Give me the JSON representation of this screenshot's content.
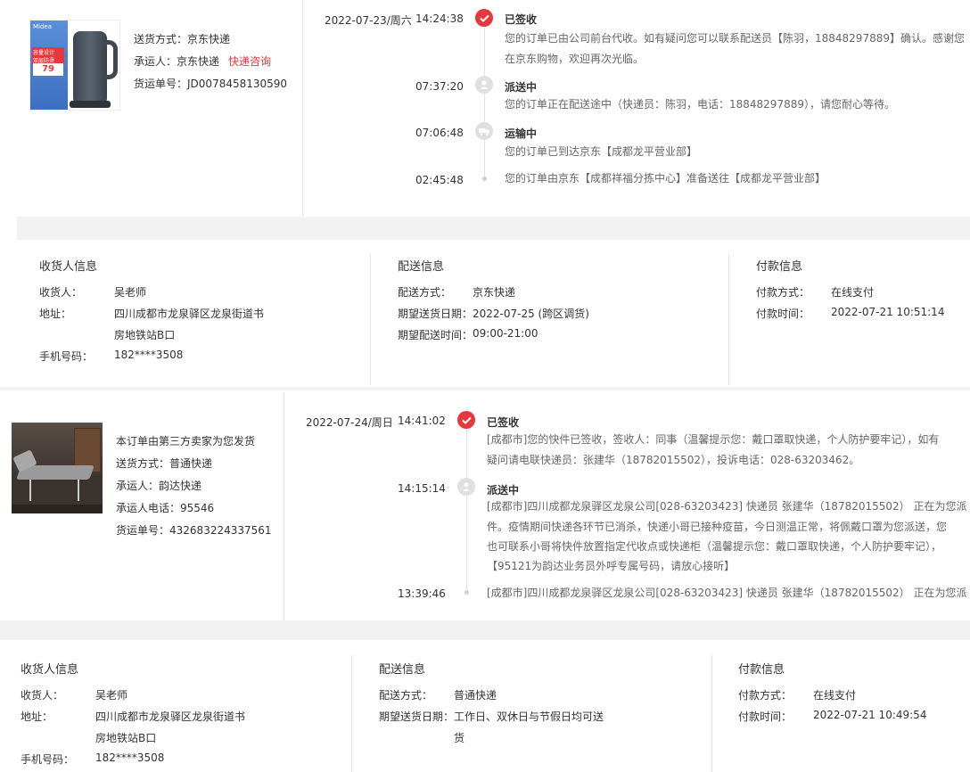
{
  "order1": {
    "shipping": {
      "method_label": "送货方式：",
      "method_value": "京东快递",
      "carrier_label": "承运人：",
      "carrier_value": "京东快递",
      "carrier_link": "快递咨询",
      "tracking_label": "货运单号：",
      "tracking_value": "JD0078458130590"
    },
    "product_image": {
      "brand_text": "Midea",
      "badge_line1": "容量设计",
      "badge_line2": "双层防烫",
      "price": "79"
    },
    "timeline": {
      "date": "2022-07-23/周六",
      "events": [
        {
          "time": "14:24:38",
          "status": "已签收",
          "desc": "您的订单已由公司前台代收。如有疑问您可以联系配送员【陈羽，18848297889】确认。感谢您在京东购物，欢迎再次光临。"
        },
        {
          "time": "07:37:20",
          "status": "派送中",
          "desc": "您的订单正在配送途中（快递员：陈羽，电话：18848297889），请您耐心等待。"
        },
        {
          "time": "07:06:48",
          "status": "运输中",
          "desc": "您的订单已到达京东【成都龙平营业部】"
        },
        {
          "time": "02:45:48",
          "status": "",
          "desc": "您的订单由京东【成都祥福分拣中心】准备送往【成都龙平营业部】"
        }
      ]
    },
    "info": {
      "receiver_title": "收货人信息",
      "receiver_name_label": "收货人：",
      "receiver_name": "吴老师",
      "address_label": "地址：",
      "address_line1": "四川成都市龙泉驿区龙泉街道书",
      "address_line2": "房地铁站B口",
      "phone_label": "手机号码：",
      "phone": "182****3508",
      "delivery_title": "配送信息",
      "delivery_method_label": "配送方式：",
      "delivery_method": "京东快递",
      "expected_date_label": "期望送货日期：",
      "expected_date": "2022-07-25 (跨区调货)",
      "expected_time_label": "期望配送时间：",
      "expected_time": "09:00-21:00",
      "payment_title": "付款信息",
      "payment_method_label": "付款方式：",
      "payment_method": "在线支付",
      "payment_time_label": "付款时间：",
      "payment_time": "2022-07-21 10:51:14"
    }
  },
  "order2": {
    "shipping": {
      "third_party_note": "本订单由第三方卖家为您发货",
      "method_label": "送货方式：",
      "method_value": "普通快递",
      "carrier_label": "承运人：",
      "carrier_value": "韵达快递",
      "carrier_phone_label": "承运人电话：",
      "carrier_phone": "95546",
      "tracking_label": "货运单号：",
      "tracking_value": "432683224337561"
    },
    "timeline": {
      "date": "2022-07-24/周日",
      "events": [
        {
          "time": "14:41:02",
          "status": "已签收",
          "desc_line1": "[成都市]您的快件已签收，签收人：同事（温馨提示您：戴口罩取快递，个人防护要牢记），如有",
          "desc_line2": "疑问请电联快递员：张建华（18782015502），投诉电话：028-63203462。"
        },
        {
          "time": "14:15:14",
          "status": "派送中",
          "desc_line1": "[成都市]四川成都龙泉驿区龙泉公司[028-63203423] 快递员 张建华（18782015502） 正在为您派",
          "desc_line2": "件。疫情期间快递各环节已消杀，快递小哥已接种疫苗，今日测温正常，将佩戴口罩为您派送，您",
          "desc_line3": "也可联系小哥将快件放置指定代收点或快递柜（温馨提示您：戴口罩取快递，个人防护要牢记），",
          "desc_line4": "【95121为韵达业务员外呼专属号码，请放心接听】"
        },
        {
          "time": "13:39:46",
          "status": "",
          "desc_line1": "[成都市]四川成都龙泉驿区龙泉公司[028-63203423] 快递员 张建华（18782015502） 正在为您派"
        }
      ]
    },
    "info": {
      "receiver_title": "收货人信息",
      "receiver_name_label": "收货人：",
      "receiver_name": "吴老师",
      "address_label": "地址：",
      "address_line1": "四川成都市龙泉驿区龙泉街道书",
      "address_line2": "房地铁站B口",
      "phone_label": "手机号码：",
      "phone": "182****3508",
      "delivery_title": "配送信息",
      "delivery_method_label": "配送方式：",
      "delivery_method": "普通快递",
      "expected_date_label": "期望送货日期：",
      "expected_date_line1": "工作日、双休日与节假日均可送",
      "expected_date_line2": "货",
      "payment_title": "付款信息",
      "payment_method_label": "付款方式：",
      "payment_method": "在线支付",
      "payment_time_label": "付款时间：",
      "payment_time": "2022-07-21 10:49:54"
    }
  }
}
